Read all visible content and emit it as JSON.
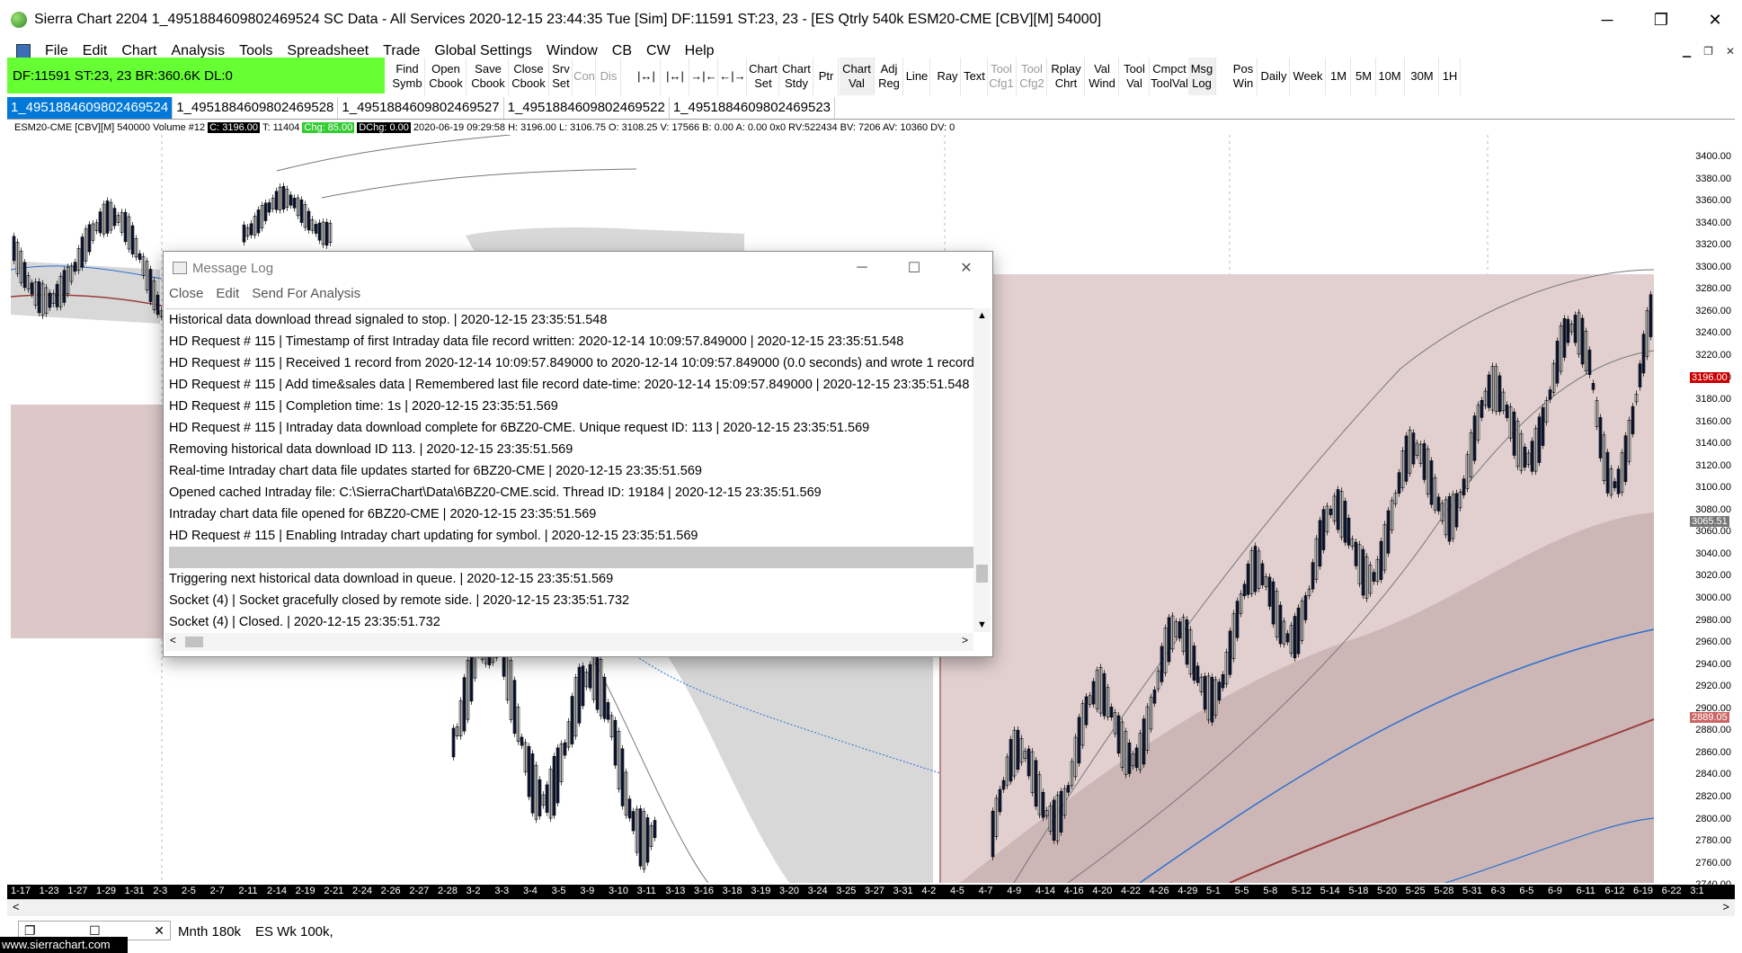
{
  "window": {
    "title": "Sierra Chart 2204 1_4951884609802469524  SC Data - All Services 2020-12-15  23:44:35 Tue [Sim]  DF:11591  ST:23, 23  - [ES Qtrly 540k ESM20-CME [CBV][M]  54000]",
    "minimize": "─",
    "restore": "❐",
    "close": "✕"
  },
  "menu": [
    "File",
    "Edit",
    "Chart",
    "Analysis",
    "Tools",
    "Spreadsheet",
    "Trade",
    "Global Settings",
    "Window",
    "CB",
    "CW",
    "Help"
  ],
  "status_box": "DF:11591  ST:23, 23  BR:360.6K  DL:0",
  "toolbar": [
    {
      "l1": "Find",
      "l2": "Symb"
    },
    {
      "l1": "Open",
      "l2": "Cbook"
    },
    {
      "l1": "Save",
      "l2": "Cbook"
    },
    {
      "l1": "Close",
      "l2": "Cbook"
    },
    {
      "l1": "Srv",
      "l2": "Set"
    },
    {
      "l1": "Con",
      "l2": ""
    },
    {
      "l1": "Dis",
      "l2": ""
    },
    {
      "l1": "|↔|",
      "l2": ""
    },
    {
      "l1": "|↔|",
      "l2": ""
    },
    {
      "l1": "→|←",
      "l2": ""
    },
    {
      "l1": "←|→",
      "l2": ""
    },
    {
      "l1": "Chart",
      "l2": "Set"
    },
    {
      "l1": "Chart",
      "l2": "Stdy"
    },
    {
      "l1": "Ptr",
      "l2": ""
    },
    {
      "l1": "Chart",
      "l2": "Val"
    },
    {
      "l1": "Adj",
      "l2": "Reg"
    },
    {
      "l1": "Line",
      "l2": ""
    },
    {
      "l1": "Ray",
      "l2": ""
    },
    {
      "l1": "Text",
      "l2": ""
    },
    {
      "l1": "Tool",
      "l2": "Cfg1"
    },
    {
      "l1": "Tool",
      "l2": "Cfg2"
    },
    {
      "l1": "Rplay",
      "l2": "Chrt"
    },
    {
      "l1": "Val",
      "l2": "Wind"
    },
    {
      "l1": "Tool",
      "l2": "Val"
    },
    {
      "l1": "Cmpct",
      "l2": "ToolVal"
    },
    {
      "l1": "Msg",
      "l2": "Log"
    },
    {
      "l1": "Pos",
      "l2": "Win"
    },
    {
      "l1": "Daily",
      "l2": ""
    },
    {
      "l1": "Week",
      "l2": ""
    },
    {
      "l1": "1M",
      "l2": ""
    },
    {
      "l1": "5M",
      "l2": ""
    },
    {
      "l1": "10M",
      "l2": ""
    },
    {
      "l1": "30M",
      "l2": ""
    },
    {
      "l1": "1H",
      "l2": ""
    }
  ],
  "tabs": [
    "1_4951884609802469524",
    "1_4951884609802469528",
    "1_4951884609802469527",
    "1_4951884609802469522",
    "1_4951884609802469523"
  ],
  "info": {
    "symbol": "ESM20-CME [CBV][M]  540000 Volume  #12",
    "close": "C: 3196.00",
    "t": "T: 11404",
    "chg": "Chg: 85.00",
    "dchg": "DChg: 0.00",
    "rest": "2020-06-19 09:29:58 H: 3196.00 L: 3106.75 O: 3108.25 V: 17566 B: 0.00 A: 0.00 0x0 RV:522434 BV: 7206 AV: 10360 DV: 0"
  },
  "y_axis": [
    "3400.00",
    "3380.00",
    "3360.00",
    "3340.00",
    "3320.00",
    "3300.00",
    "3280.00",
    "3260.00",
    "3240.00",
    "3220.00",
    "3200.00",
    "3180.00",
    "3160.00",
    "3140.00",
    "3120.00",
    "3100.00",
    "3080.00",
    "3060.00",
    "3040.00",
    "3020.00",
    "3000.00",
    "2980.00",
    "2960.00",
    "2940.00",
    "2920.00",
    "2900.00",
    "2880.00",
    "2860.00",
    "2840.00",
    "2820.00",
    "2800.00",
    "2780.00",
    "2760.00",
    "2740.00"
  ],
  "price_tags": {
    "last": "3196.00",
    "mid": "3065.51",
    "low": "2889.05"
  },
  "x_axis": [
    "1-17",
    "1-23",
    "1-27",
    "1-29",
    "1-31",
    "2-3",
    "2-5",
    "2-7",
    "2-11",
    "2-14",
    "2-19",
    "2-21",
    "2-24",
    "2-26",
    "2-27",
    "2-28",
    "3-2",
    "3-3",
    "3-4",
    "3-5",
    "3-9",
    "3-10",
    "3-11",
    "3-13",
    "3-16",
    "3-18",
    "3-19",
    "3-20",
    "3-24",
    "3-25",
    "3-27",
    "3-31",
    "4-2",
    "4-5",
    "4-7",
    "4-9",
    "4-14",
    "4-16",
    "4-20",
    "4-22",
    "4-26",
    "4-29",
    "5-1",
    "5-5",
    "5-8",
    "5-12",
    "5-14",
    "5-18",
    "5-20",
    "5-25",
    "5-28",
    "5-31",
    "6-3",
    "6-5",
    "6-9",
    "6-11",
    "6-12",
    "6-19",
    "6-22",
    "3:1"
  ],
  "dialog": {
    "title": "Message Log",
    "menu": [
      "Close",
      "Edit",
      "Send For Analysis"
    ],
    "lines": [
      "Historical data download thread signaled to stop. | 2020-12-15  23:35:51.548",
      "HD Request # 115 | Timestamp of first Intraday data file record written: 2020-12-14  10:09:57.849000 | 2020-12-15  23:35:51.548",
      "HD Request # 115 | Received 1 record from 2020-12-14  10:09:57.849000 to 2020-12-14  10:09:57.849000 (0.0 seconds) and wrote 1 record",
      "HD Request # 115 | Add time&sales data | Remembered last file record date-time: 2020-12-14  15:09:57.849000 | 2020-12-15  23:35:51.548",
      "HD Request # 115 | Completion time: 1s | 2020-12-15  23:35:51.569",
      "HD Request # 115 |  Intraday data  download complete for 6BZ20-CME. Unique request ID: 113 | 2020-12-15  23:35:51.569",
      "Removing historical data download ID 113. | 2020-12-15  23:35:51.569",
      "Real-time Intraday chart data file updates started for 6BZ20-CME | 2020-12-15  23:35:51.569",
      "Opened cached Intraday file: C:\\SierraChart\\Data\\6BZ20-CME.scid. Thread ID: 19184 | 2020-12-15  23:35:51.569",
      "Intraday chart data file opened for 6BZ20-CME | 2020-12-15  23:35:51.569",
      "HD Request # 115 | Enabling Intraday chart updating for symbol. | 2020-12-15  23:35:51.569",
      "",
      "Triggering next historical data download in queue. | 2020-12-15  23:35:51.569",
      "Socket (4) | Socket gracefully closed by remote side. | 2020-12-15  23:35:51.732",
      "Socket (4) | Closed. | 2020-12-15  23:35:51.732"
    ]
  },
  "bottom_tabs": [
    "Mnth 180k",
    "ES Wk 100k,"
  ],
  "watermark": "www.sierrachart.com",
  "colors": {
    "status_green": "#66ff33",
    "tab_active": "#0078d7",
    "shade_pink": "#dcc8c8",
    "band_gray": "#d8d8d8",
    "ma_blue": "#2b6fd0",
    "ma_red": "#9b3b3b"
  }
}
